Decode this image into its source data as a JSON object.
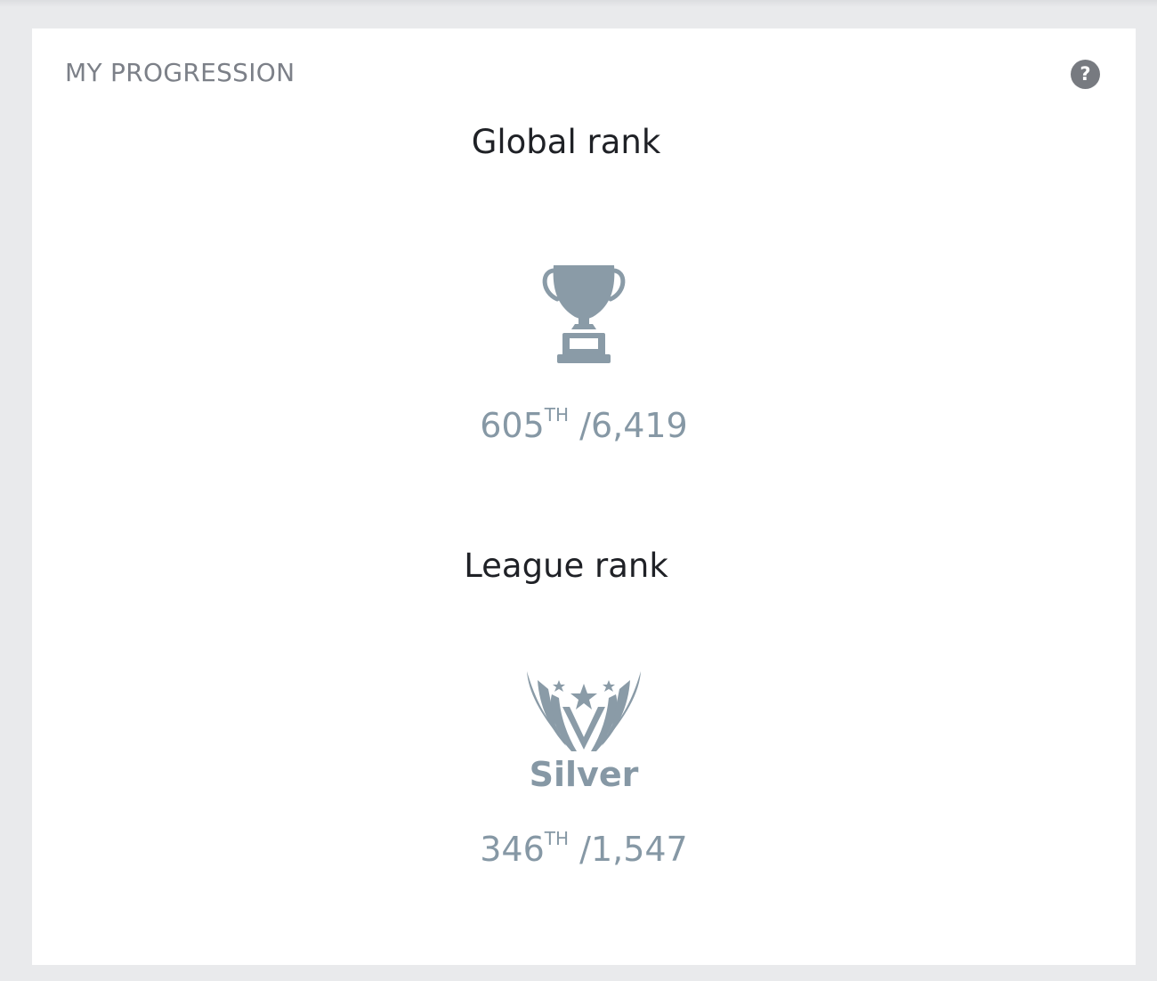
{
  "panel": {
    "title": "MY PROGRESSION",
    "help_icon": "question-circle-icon",
    "help_symbol": "?"
  },
  "global_rank": {
    "title": "Global rank",
    "icon": "trophy-icon",
    "position": "605",
    "suffix": "TH",
    "total": "/6,419"
  },
  "league_rank": {
    "title": "League rank",
    "icon": "league-emblem-icon",
    "league_name": "Silver",
    "position": "346",
    "suffix": "TH",
    "total": "/1,547"
  },
  "colors": {
    "page_background": "#e9eaec",
    "card_background": "#ffffff",
    "muted_text": "#7c8088",
    "rank_accent": "#8698a5",
    "heading_text": "#1f2126"
  }
}
